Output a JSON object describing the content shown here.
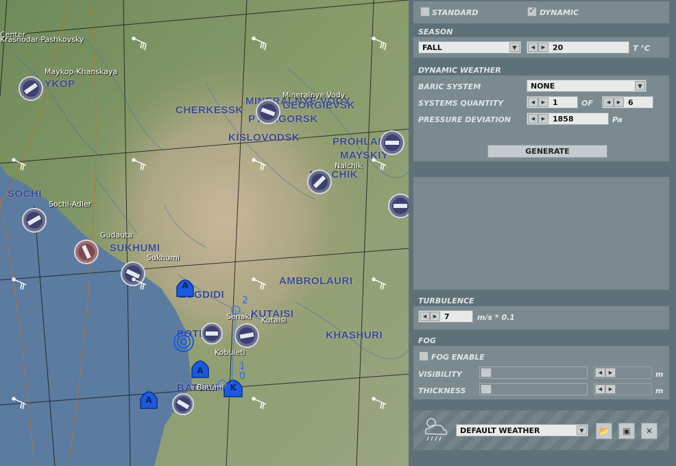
{
  "map": {
    "cities": [
      {
        "name": "YKOP"
      },
      {
        "name": "CHERKESSK"
      },
      {
        "name": "MINERALNYE VODY"
      },
      {
        "name": "GEORGIEVSK"
      },
      {
        "name": "PYATIGORSK"
      },
      {
        "name": "KISLOVODSK"
      },
      {
        "name": "PROHLADNY"
      },
      {
        "name": "MAYSKIY"
      },
      {
        "name": "NALCHIK"
      },
      {
        "name": "SOCHI"
      },
      {
        "name": "SUKHUMI"
      },
      {
        "name": "ZUGDIDI"
      },
      {
        "name": "AMBROLAURI"
      },
      {
        "name": "KUTAISI"
      },
      {
        "name": "KHASHURI"
      },
      {
        "name": "POTI"
      },
      {
        "name": "BATUMI"
      }
    ],
    "airfields": [
      {
        "name": "Center"
      },
      {
        "name": "Krasnodar-Pashkovsky"
      },
      {
        "name": "Maykop-Khanskaya"
      },
      {
        "name": "Mineralnye Vody"
      },
      {
        "name": "Nalchik"
      },
      {
        "name": "Sochi-Adler"
      },
      {
        "name": "Gudauta"
      },
      {
        "name": "Sukhumi"
      },
      {
        "name": "Senaki"
      },
      {
        "name": "Kutaisi"
      },
      {
        "name": "Kobuleti"
      },
      {
        "name": "Batumi"
      }
    ],
    "markers": {
      "a1": "A",
      "a2": "A",
      "a3": "A",
      "k": "K"
    },
    "route_numbers": {
      "n2": "2",
      "n1": "1",
      "n0": "0"
    }
  },
  "panel": {
    "mode": {
      "standard_label": "STANDARD",
      "standard_checked": false,
      "dynamic_label": "DYNAMIC",
      "dynamic_checked": true
    },
    "season": {
      "header": "SEASON",
      "value": "FALL",
      "temperature": "20",
      "temp_unit": "T °C"
    },
    "dynamic_weather": {
      "header": "DYNAMIC WEATHER",
      "baric_label": "BARIC SYSTEM",
      "baric_value": "NONE",
      "systems_label": "SYSTEMS QUANTITY",
      "systems_value": "1",
      "of_label": "OF",
      "systems_max": "6",
      "pressure_label": "PRESSURE DEVIATION",
      "pressure_value": "1858",
      "pressure_unit": "Pa",
      "generate_label": "GENERATE"
    },
    "turbulence": {
      "header": "TURBULENCE",
      "value": "7",
      "unit": "m/s * 0.1"
    },
    "fog": {
      "header": "FOG",
      "enable_label": "FOG ENABLE",
      "enabled": false,
      "visibility_label": "VISIBILITY",
      "visibility_unit": "m",
      "thickness_label": "THICKNESS",
      "thickness_unit": "m"
    },
    "preset": {
      "value": "DEFAULT WEATHER"
    },
    "colors": {
      "panel_bg": "#5f7178",
      "section_bg": "#7b8a90",
      "label": "#dfe4e6",
      "sea": "#5a7aa0",
      "city_label": "#3f4a8a",
      "marker": "#1a5ae0"
    }
  }
}
